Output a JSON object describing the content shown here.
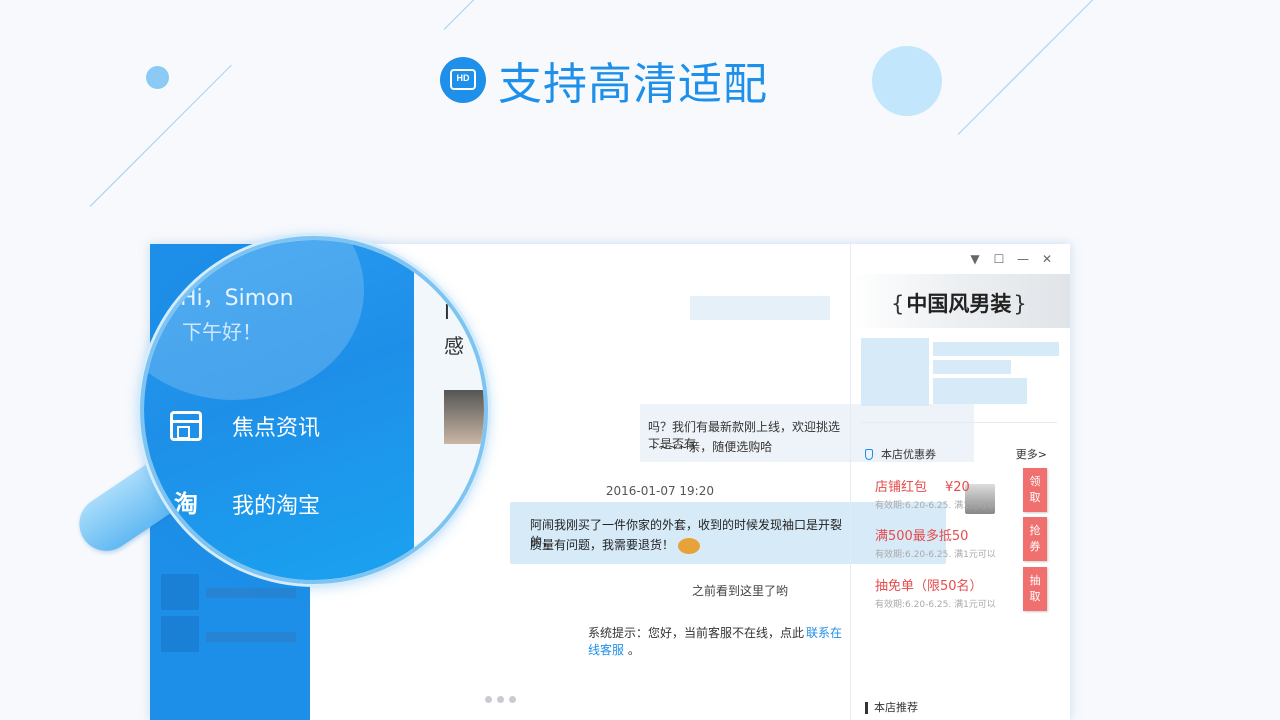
{
  "headline": {
    "icon": "hd-screen-icon",
    "badge_text": "HD",
    "text": "支持高清适配"
  },
  "colors": {
    "accent": "#1e90ea",
    "sidebar": "#1e8fe8",
    "coupon_red": "#e54c4c",
    "coupon_tab": "#f07070",
    "bubble": "#d6eaf8"
  },
  "window": {
    "controls": [
      {
        "name": "dropdown",
        "glyph": "▼"
      },
      {
        "name": "maximize",
        "glyph": "☐"
      },
      {
        "name": "minimize",
        "glyph": "—"
      },
      {
        "name": "close",
        "glyph": "✕"
      }
    ]
  },
  "sidebar": {
    "greeting": "Hi，Simon",
    "greeting_sub": "下午好！",
    "items": [
      {
        "label": "焦点资讯",
        "icon": "news-icon"
      },
      {
        "label": "我的淘宝",
        "icon": "taobao-icon",
        "glyph": "淘"
      }
    ]
  },
  "chat": {
    "incoming": {
      "lines": [
        "吗？我们有最新款刚上线，欢迎挑选下是否有",
        "~~~~亲，随便选购哈"
      ]
    },
    "outgoing": {
      "timestamp": "2016-01-07  19:20",
      "lines": [
        "阿闹我刚买了一件你家的外套，收到的时候发现袖口是开裂的，",
        "质量有问题，我需要退货！"
      ]
    },
    "divider": "之前看到这里了哟",
    "system_notice": {
      "prefix": "系统提示：您好，当前客服不在线，点此",
      "link": "联系在线客服",
      "suffix": "。"
    },
    "title_partial": [
      "I",
      "感"
    ]
  },
  "shop": {
    "name": "中国风男装",
    "coupons_header": "本店优惠券",
    "more": "更多>",
    "coupons": [
      {
        "title": "店铺红包",
        "amount": "¥20",
        "validity": "有效期:6.20-6.25. 满1元可以",
        "action": "领\n取"
      },
      {
        "title": "满500最多抵50",
        "amount": "",
        "validity": "有效期:6.20-6.25. 满1元可以",
        "action": "抢\n券"
      },
      {
        "title": "抽免单（限50名）",
        "amount": "",
        "validity": "有效期:6.20-6.25. 满1元可以",
        "action": "抽\n取"
      }
    ],
    "recommend": "本店推荐"
  }
}
